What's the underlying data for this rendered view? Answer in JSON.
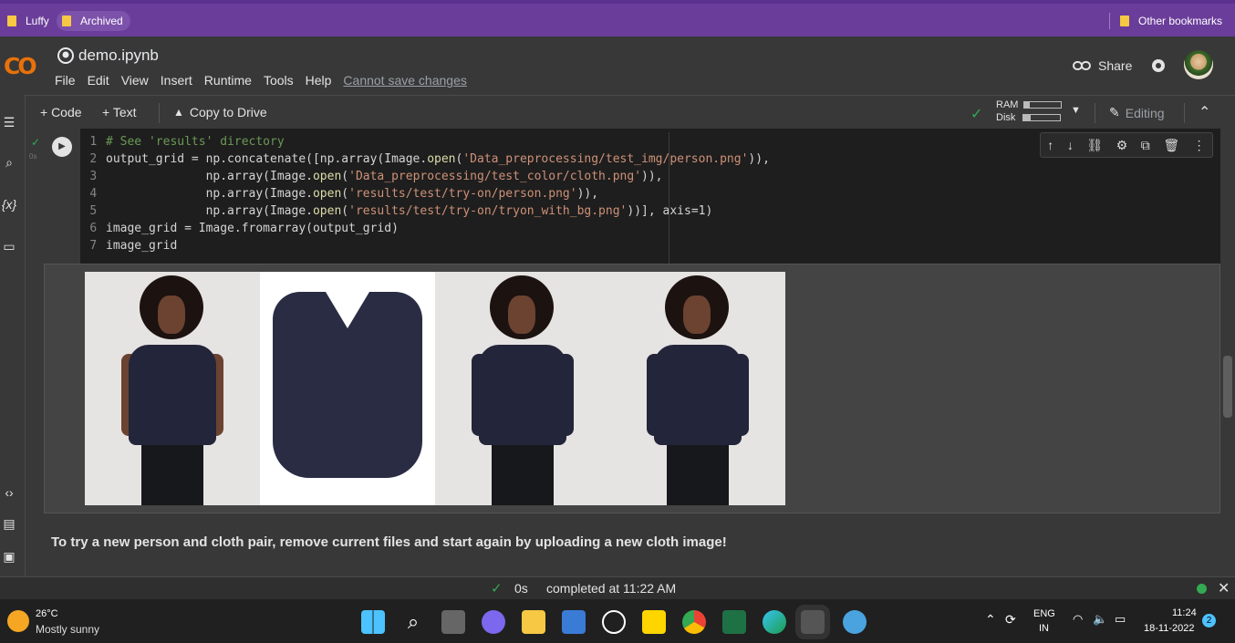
{
  "bookmarks": {
    "items": [
      "Luffy",
      "Archived"
    ],
    "other": "Other bookmarks"
  },
  "header": {
    "logo": "CO",
    "notebook_title": "demo.ipynb",
    "menu": [
      "File",
      "Edit",
      "View",
      "Insert",
      "Runtime",
      "Tools",
      "Help"
    ],
    "save_status": "Cannot save changes",
    "share_label": "Share"
  },
  "toolbar": {
    "add_code": "+ Code",
    "add_text": "+ Text",
    "copy_to_drive": "Copy to Drive",
    "ram_label": "RAM",
    "disk_label": "Disk",
    "ram_level": 0.15,
    "disk_level": 0.2,
    "editing_label": "Editing"
  },
  "cell": {
    "exec_time": "0s",
    "lines": [
      {
        "n": "1",
        "parts": [
          {
            "c": "cm",
            "t": "# See 'results' directory"
          }
        ]
      },
      {
        "n": "2",
        "parts": [
          {
            "c": "tx",
            "t": "output_grid = np.concatenate([np.array(Image."
          },
          {
            "c": "fn",
            "t": "open"
          },
          {
            "c": "tx",
            "t": "("
          },
          {
            "c": "st",
            "t": "'Data_preprocessing/test_img/person.png'"
          },
          {
            "c": "tx",
            "t": ")),"
          }
        ]
      },
      {
        "n": "3",
        "parts": [
          {
            "c": "tx",
            "t": "              np.array(Image."
          },
          {
            "c": "fn",
            "t": "open"
          },
          {
            "c": "tx",
            "t": "("
          },
          {
            "c": "st",
            "t": "'Data_preprocessing/test_color/cloth.png'"
          },
          {
            "c": "tx",
            "t": ")),"
          }
        ]
      },
      {
        "n": "4",
        "parts": [
          {
            "c": "tx",
            "t": "              np.array(Image."
          },
          {
            "c": "fn",
            "t": "open"
          },
          {
            "c": "tx",
            "t": "("
          },
          {
            "c": "st",
            "t": "'results/test/try-on/person.png'"
          },
          {
            "c": "tx",
            "t": ")),"
          }
        ]
      },
      {
        "n": "5",
        "parts": [
          {
            "c": "tx",
            "t": "              np.array(Image."
          },
          {
            "c": "fn",
            "t": "open"
          },
          {
            "c": "tx",
            "t": "("
          },
          {
            "c": "st",
            "t": "'results/test/try-on/tryon_with_bg.png'"
          },
          {
            "c": "tx",
            "t": "))], axis=1)"
          }
        ]
      },
      {
        "n": "6",
        "parts": [
          {
            "c": "tx",
            "t": "image_grid = Image.fromarray(output_grid)"
          }
        ]
      },
      {
        "n": "7",
        "parts": [
          {
            "c": "tx",
            "t": "image_grid"
          }
        ]
      }
    ]
  },
  "text_cell": "To try a new person and cloth pair, remove current files and start again by uploading a new cloth image!",
  "status": {
    "time": "0s",
    "completed": "completed at 11:22 AM"
  },
  "taskbar": {
    "temp": "26°C",
    "weather": "Mostly sunny",
    "lang_top": "ENG",
    "lang_bottom": "IN",
    "time": "11:24",
    "date": "18-11-2022",
    "notif_count": "2"
  },
  "colors": {
    "accent_purple": "#6a3d9a",
    "colab_orange": "#f9ab00",
    "check_green": "#34a853"
  }
}
